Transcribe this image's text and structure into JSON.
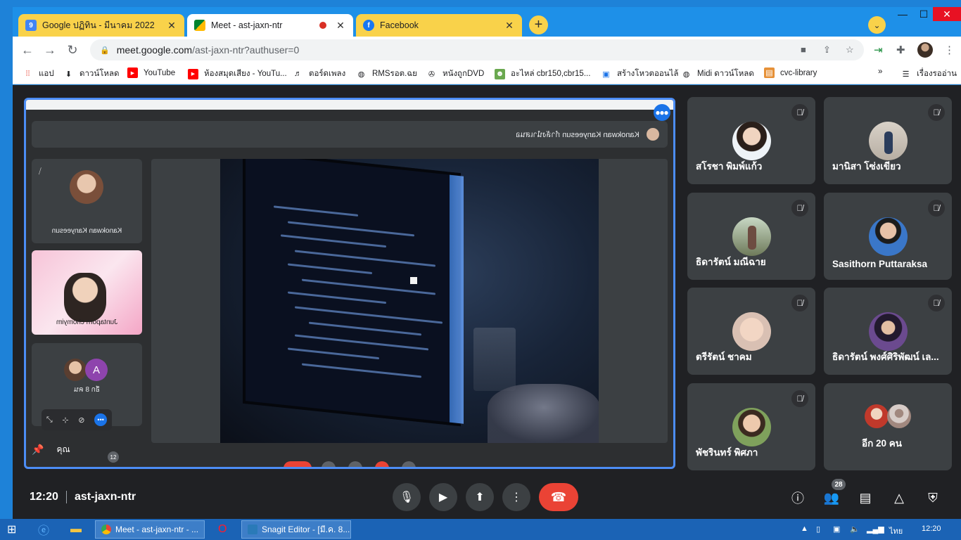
{
  "tabs": [
    {
      "title": "Google ปฏิทิน - มีนาคม 2022",
      "favicon_text": "9",
      "color": "#f9d24a"
    },
    {
      "title": "Meet - ast-jaxn-ntr",
      "active": true
    },
    {
      "title": "Facebook",
      "color": "#f9d24a"
    }
  ],
  "window_controls": {
    "minimize": "—",
    "maximize": "☐",
    "close": "✕"
  },
  "address_bar": {
    "host": "meet.google.com",
    "path": "/ast-jaxn-ntr?authuser=0"
  },
  "bookmarks": [
    {
      "label": "แอป",
      "icon": "apps-grid-icon"
    },
    {
      "label": "ดาวน์โหลด",
      "icon": "download-icon"
    },
    {
      "label": "YouTube",
      "icon": "youtube-icon"
    },
    {
      "label": "ห้องสมุดเสียง - YouTu...",
      "icon": "youtube-icon"
    },
    {
      "label": "ตอร์ดเพลง",
      "icon": "music-icon"
    },
    {
      "label": "RMSรอต.ฉย",
      "icon": "globe-icon"
    },
    {
      "label": "หนังถูกDVD",
      "icon": "film-reel-icon"
    },
    {
      "label": "อะไหล่ cbr150,cbr15...",
      "icon": "frog-icon"
    },
    {
      "label": "สร้างโหวตออนไล้",
      "icon": "vote-icon"
    },
    {
      "label": "Midi ดาวน์โหลด",
      "icon": "globe-icon"
    },
    {
      "label": "cvc-library",
      "icon": "library-icon"
    },
    {
      "label": "เรื่องรออ่าน",
      "icon": "reading-list-icon"
    }
  ],
  "presentation": {
    "banner_text": "Kanokwan Kanyeesun กำลังนำเสนอ",
    "mini_tiles": [
      {
        "name": "Kanokwan Kanyeesun"
      },
      {
        "name": "Juntaporn chomyim"
      },
      {
        "name": "อีก 8 คน",
        "letter": "A"
      }
    ],
    "you_label": "คุณ",
    "badge_count": "12"
  },
  "participants": [
    {
      "name": "สโรชา พิมพ์แก้ว"
    },
    {
      "name": "มานิสา โซ่งเขียว"
    },
    {
      "name": "ธิดารัตน์ มณีฉาย"
    },
    {
      "name": "Sasithorn Puttaraksa"
    },
    {
      "name": "ตรีรัตน์ ชาคม"
    },
    {
      "name": "ธิดารัตน์ พงศ์ศิริพัฒน์ เล..."
    },
    {
      "name": "พัชรินทร์ พิศภา"
    }
  ],
  "more_tile": {
    "label": "อีก 20 คน"
  },
  "bottom_bar": {
    "time": "12:20",
    "meeting_code": "ast-jaxn-ntr",
    "people_count": "28"
  },
  "taskbar": {
    "tasks": [
      "Meet - ast-jaxn-ntr - ...",
      "Snagit Editor - [มี.ค. 8..."
    ],
    "language": "ไทย",
    "time": "12:20"
  },
  "colors": {
    "accent": "#1a73e8",
    "end_call": "#ea4335",
    "meet_bg": "#202124",
    "tile_bg": "#3c4043"
  }
}
